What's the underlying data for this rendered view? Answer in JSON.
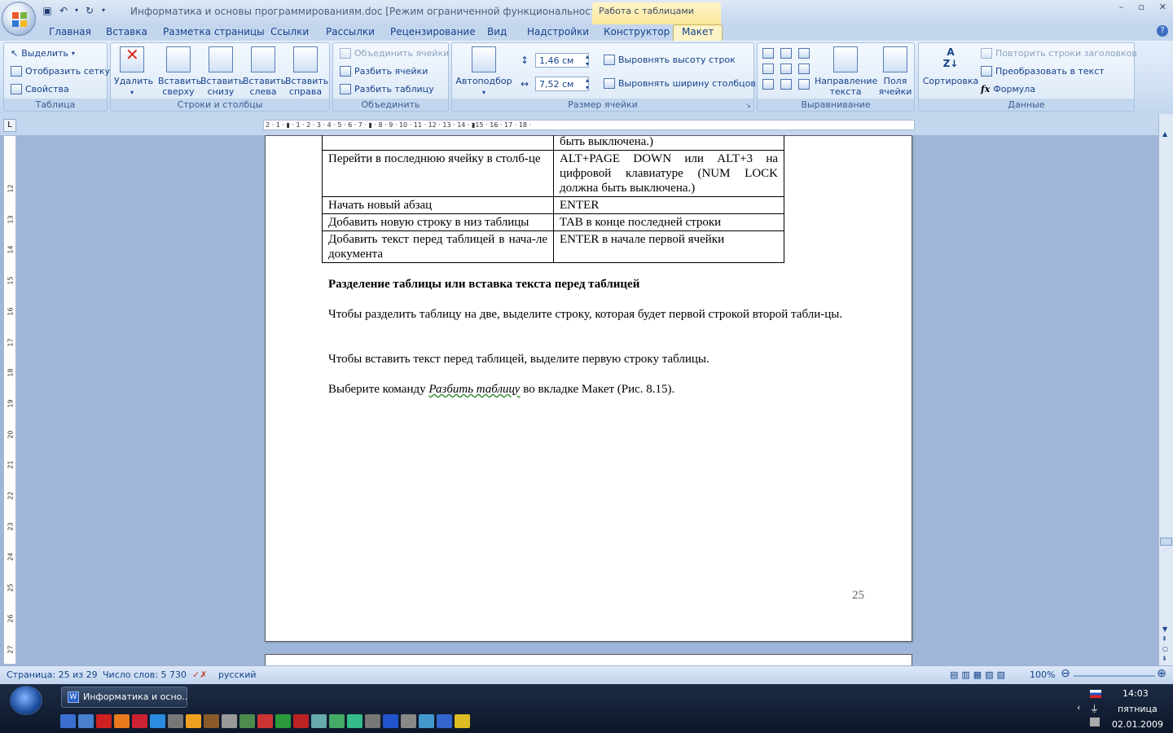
{
  "window": {
    "title": "Информатика и основы программированиям.doc [Режим ограниченной функциональности] - М...",
    "contextual_tab": "Работа с таблицами",
    "controls": [
      "–",
      "▫",
      "✕"
    ]
  },
  "tabs": [
    "Главная",
    "Вставка",
    "Разметка страницы",
    "Ссылки",
    "Рассылки",
    "Рецензирование",
    "Вид",
    "Надстройки",
    "Конструктор",
    "Макет"
  ],
  "active_tab": "Макет",
  "ribbon": {
    "table_group": {
      "label": "Таблица",
      "select": "Выделить",
      "show_grid": "Отобразить сетку",
      "properties": "Свойства"
    },
    "rows_cols_group": {
      "label": "Строки и столбцы",
      "delete": "Удалить",
      "insert_above": [
        "Вставить",
        "сверху"
      ],
      "insert_below": [
        "Вставить",
        "снизу"
      ],
      "insert_left": [
        "Вставить",
        "слева"
      ],
      "insert_right": [
        "Вставить",
        "справа"
      ]
    },
    "merge_group": {
      "label": "Объединить",
      "merge_cells": "Объединить ячейки",
      "split_cells": "Разбить ячейки",
      "split_table": "Разбить таблицу"
    },
    "cell_size_group": {
      "label": "Размер ячейки",
      "autofit": "Автоподбор",
      "height": "1,46 см",
      "width": "7,52 см",
      "distribute_rows": "Выровнять высоту строк",
      "distribute_cols": "Выровнять ширину столбцов"
    },
    "alignment_group": {
      "label": "Выравнивание",
      "text_direction": [
        "Направление",
        "текста"
      ],
      "cell_margins": [
        "Поля",
        "ячейки"
      ]
    },
    "data_group": {
      "label": "Данные",
      "sort": "Сортировка",
      "repeat_headers": "Повторить строки заголовков",
      "convert_to_text": "Преобразовать в текст",
      "formula": "Формула"
    }
  },
  "ruler": {
    "horizontal": "2 · 1 · ▮ · 1 · 2 · 3 · 4 · 5 · 6 · 7 · ▮ · 8 · 9 · 10 · 11 · 12 · 13 · 14 · ▮15 · 16 · 17 · 18 ·",
    "vertical": [
      "12",
      "13",
      "14",
      "15",
      "16",
      "17",
      "18",
      "19",
      "20",
      "21",
      "22",
      "23",
      "24",
      "25",
      "26",
      "27"
    ]
  },
  "document": {
    "table_rows": [
      {
        "action": "",
        "keys": "быть выключена.)"
      },
      {
        "action": "Перейти в последнюю ячейку в столб-це",
        "keys": "ALT+PAGE DOWN или ALT+3 на цифровой клавиатуре (NUM LOCK должна быть выключена.)"
      },
      {
        "action": "Начать новый абзац",
        "keys": "ENTER"
      },
      {
        "action": "Добавить новую строку в низ таблицы",
        "keys": "TAB в конце последней строки"
      },
      {
        "action": "Добавить текст перед таблицей в нача-ле документа",
        "keys": "ENTER в начале первой ячейки"
      }
    ],
    "heading": "Разделение таблицы или вставка текста перед таблицей",
    "para1": "Чтобы разделить таблицу на две, выделите строку, которая будет первой строкой второй табли-цы.",
    "para2": "Чтобы вставить текст перед таблицей, выделите первую строку таблицы.",
    "para3_before": "Выберите команду ",
    "para3_italic": "Разбить таблицу",
    "para3_after": " во вкладке Макет (Рис. 8.15).",
    "page_number": "25"
  },
  "status": {
    "page": "Страница: 25 из 29",
    "words": "Число слов: 5 730",
    "language": "русский",
    "zoom": "100%"
  },
  "taskbar": {
    "window_button": "Информатика и осно...",
    "time": "14:03",
    "day": "пятница",
    "date": "02.01.2009"
  },
  "colors": {
    "ribbon_bg": "#cfdff3",
    "active_tab": "#fdf3c8",
    "contextual": "#fbe69a",
    "doc_bg": "#9fb6d8",
    "taskbar": "#0c1628"
  }
}
